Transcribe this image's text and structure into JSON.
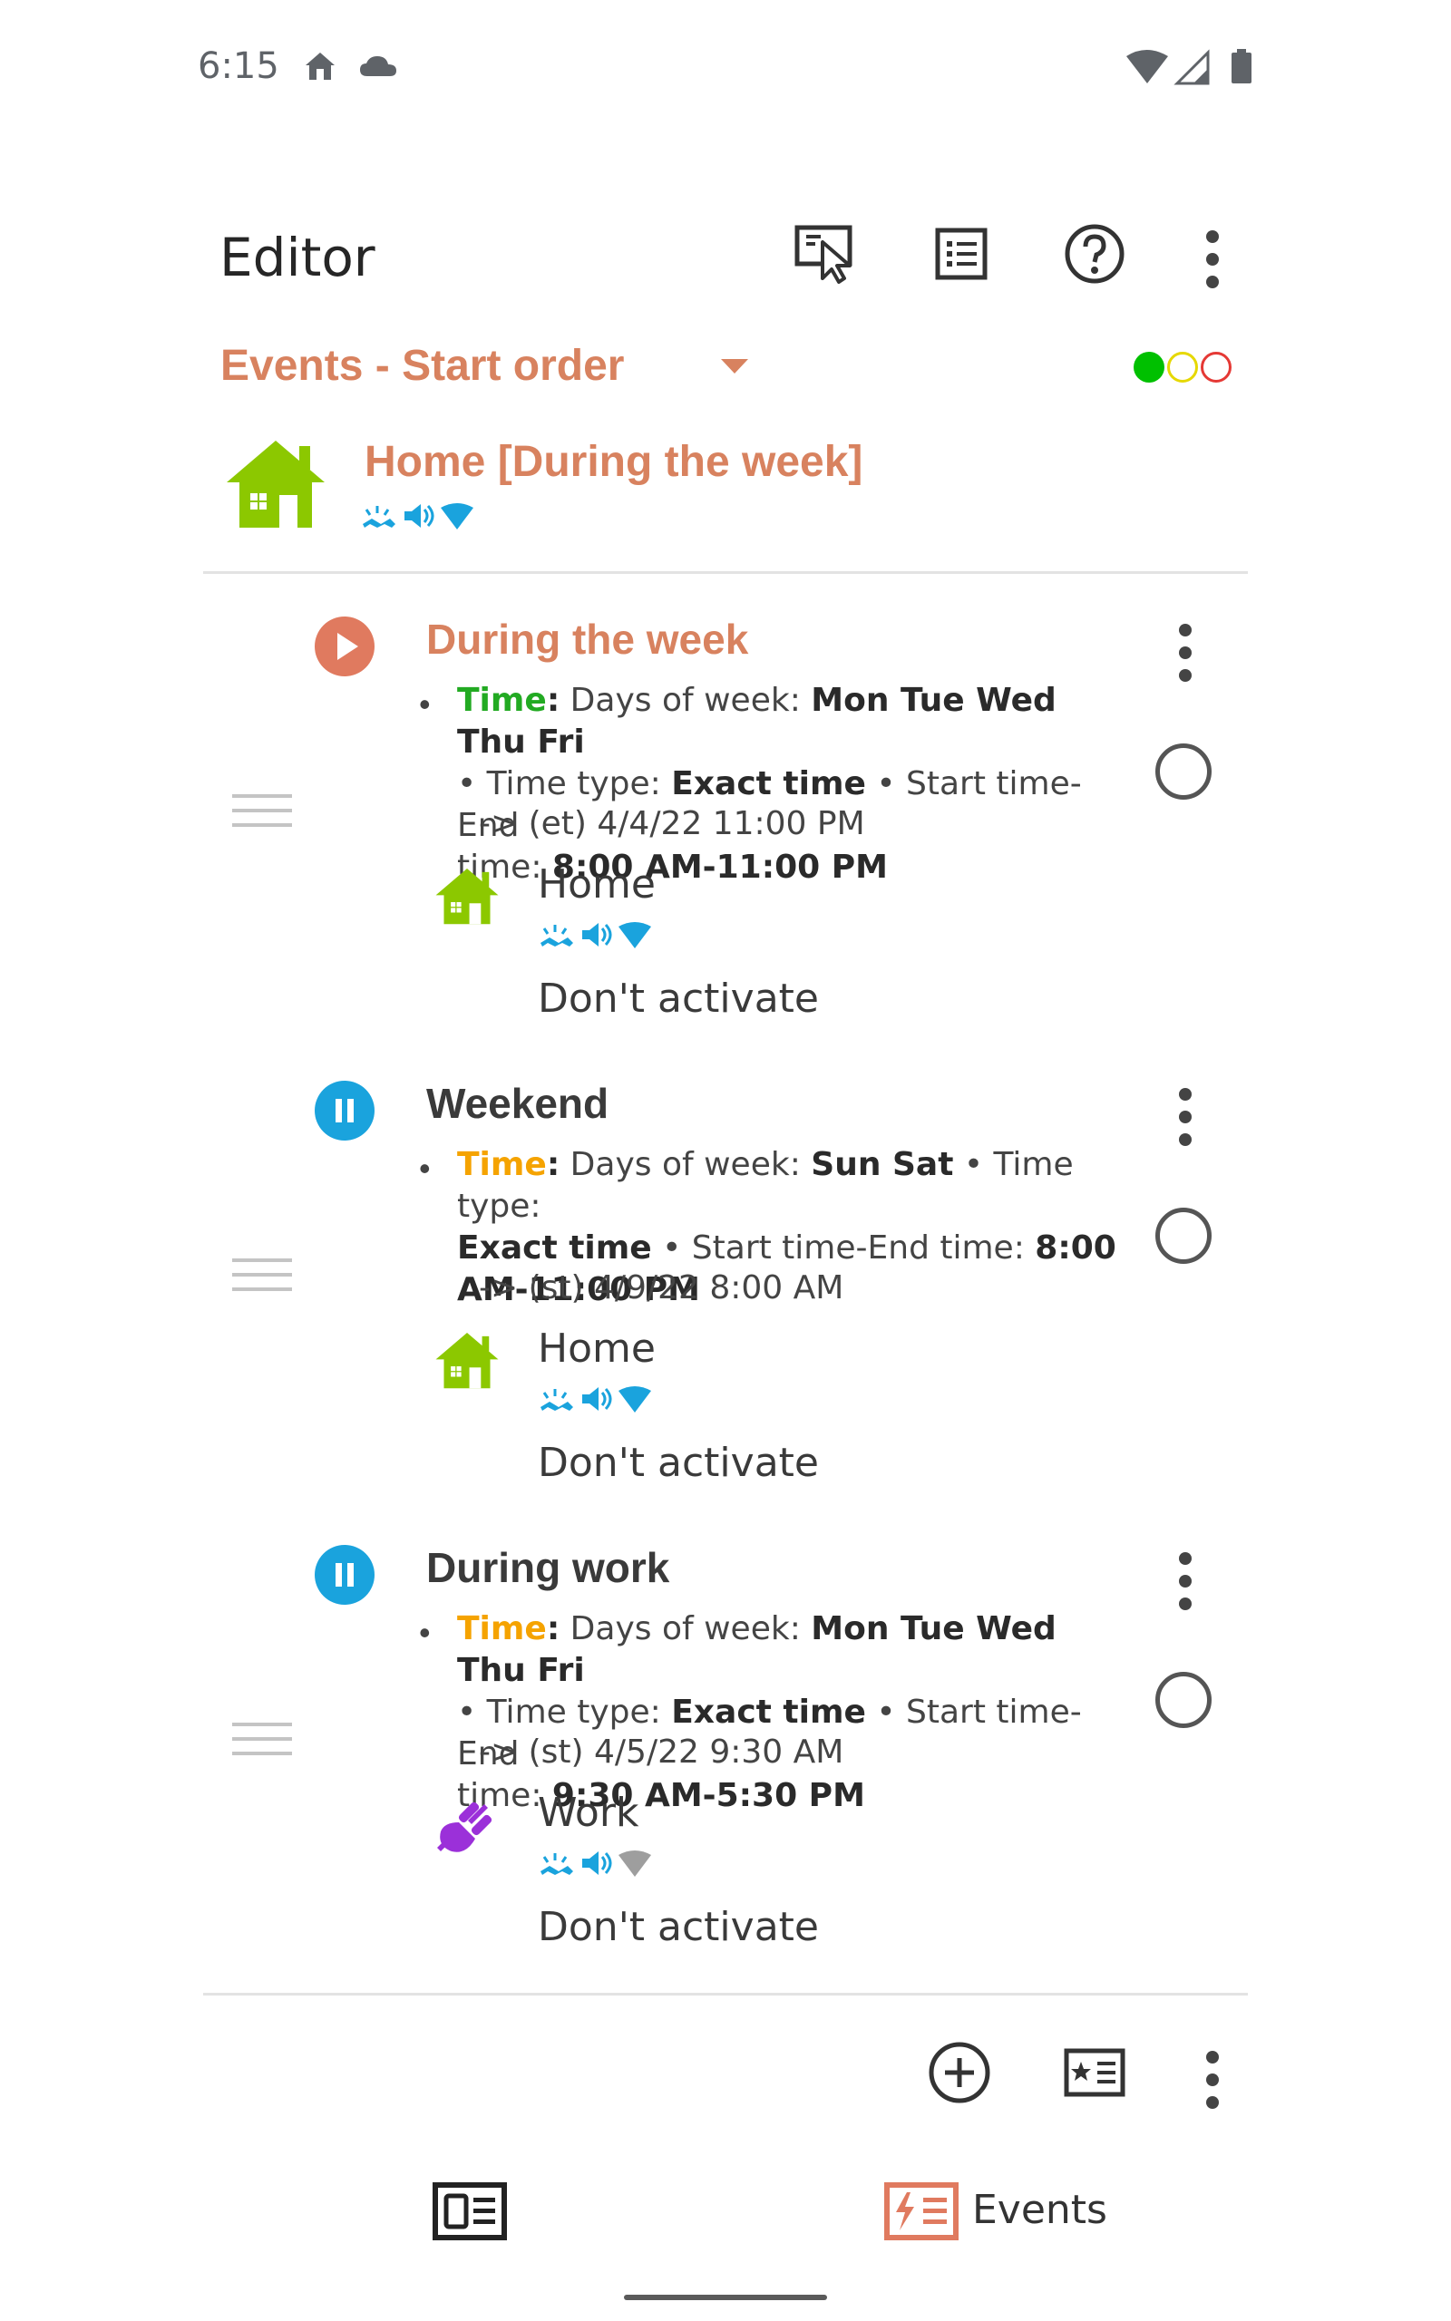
{
  "status_bar": {
    "time": "6:15"
  },
  "toolbar": {
    "title": "Editor"
  },
  "subheader": {
    "selector_label": "Events - Start order",
    "indicator_colors": [
      "#00c000",
      "#e6d800",
      "#e53935"
    ]
  },
  "active_profile": {
    "name": "Home [During the week]"
  },
  "events": [
    {
      "title": "During the week",
      "state": "running",
      "title_color": "#d8825f",
      "time_label": "Time",
      "time_label_color": "#22aa22",
      "desc_prefix": ": Days of week: ",
      "days": "Mon Tue Wed Thu Fri",
      "line2_pre": "• Time type: ",
      "time_type": "Exact time",
      "line2_post": " • Start time-End",
      "line3_pre": "time: ",
      "time_range": "8:00 AM-11:00 PM",
      "next": "-> (et) 4/4/22 11:00 PM",
      "profile_name": "Home",
      "profile_icon": "home-icon",
      "action": "Don't activate"
    },
    {
      "title": "Weekend",
      "state": "paused",
      "title_color": "#3a3a3a",
      "time_label": "Time",
      "time_label_color": "#f5a300",
      "desc_prefix": ": Days of week: ",
      "days": "Sun Sat",
      "line1_post": " • Time type:",
      "line2_bold": "Exact time",
      "line2_post": " • Start time-End time: ",
      "line2_bold2": "8:00",
      "line3_bold": "AM-11:00 PM",
      "next": "-> (st) 4/9/22 8:00 AM",
      "profile_name": "Home",
      "profile_icon": "home-icon",
      "action": "Don't activate"
    },
    {
      "title": "During work",
      "state": "paused",
      "title_color": "#3a3a3a",
      "time_label": "Time",
      "time_label_color": "#f5a300",
      "desc_prefix": ": Days of week: ",
      "days": "Mon Tue Wed Thu Fri",
      "line2_pre": "• Time type: ",
      "time_type": "Exact time",
      "line2_post": " • Start time-End",
      "line3_pre": "time: ",
      "time_range": "9:30 AM-5:30 PM",
      "next": "-> (st) 4/5/22 9:30 AM",
      "profile_name": "Work",
      "profile_icon": "work-plug-icon",
      "action": "Don't activate"
    }
  ],
  "bottom_nav": {
    "events_label": "Events"
  },
  "colors": {
    "accent": "#d8825f",
    "play": "#e07a5f",
    "pause": "#1aa3dd",
    "home_green": "#8cc800",
    "profile_icons_blue": "#1aa3dd"
  }
}
